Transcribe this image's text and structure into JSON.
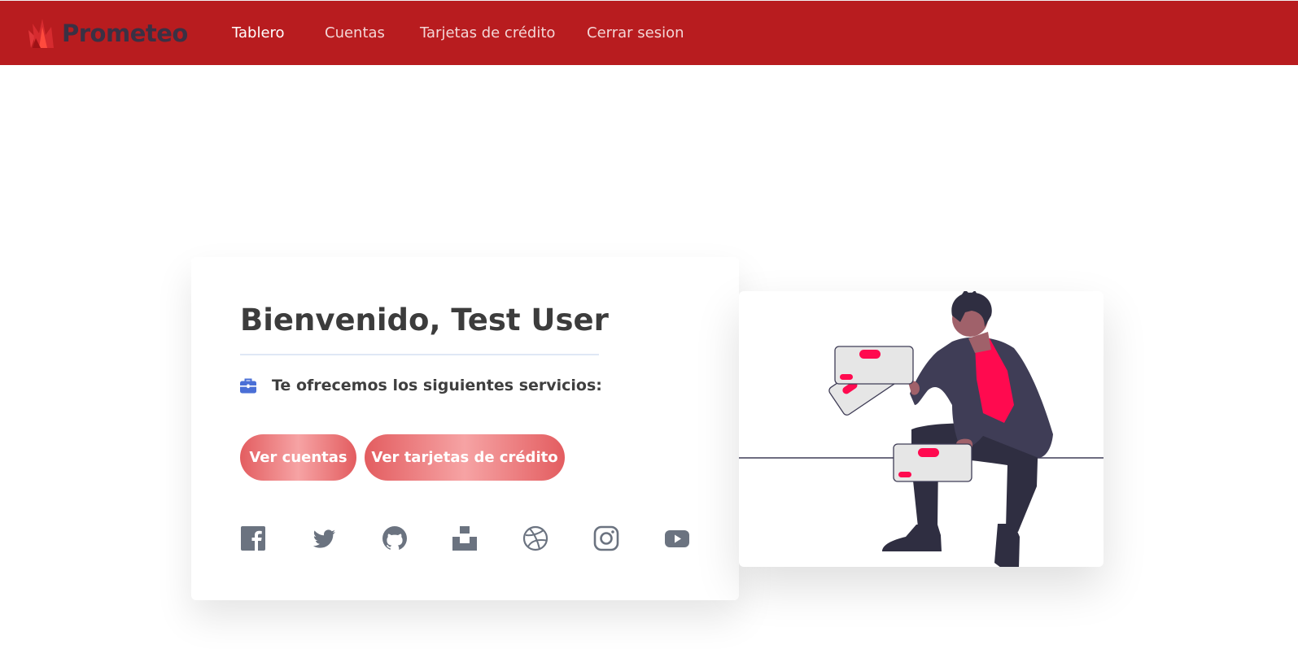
{
  "brand": {
    "name": "Prometeo"
  },
  "nav": {
    "items": [
      {
        "label": "Tablero",
        "active": true
      },
      {
        "label": "Cuentas",
        "active": false
      },
      {
        "label": "Tarjetas de crédito",
        "active": false
      },
      {
        "label": "Cerrar sesion",
        "active": false
      }
    ]
  },
  "welcome": {
    "title": "Bienvenido, Test User",
    "services_text": "Te ofrecemos los siguientes servicios:",
    "services_icon": "briefcase-icon"
  },
  "buttons": {
    "accounts": "Ver cuentas",
    "cards": "Ver tarjetas de crédito"
  },
  "social": [
    "facebook-icon",
    "twitter-icon",
    "github-icon",
    "unsplash-icon",
    "dribbble-icon",
    "instagram-icon",
    "youtube-icon"
  ],
  "colors": {
    "navbar": "#b81c1f",
    "button_gradient_edge": "#e35d60",
    "button_gradient_center": "#f6a3a4",
    "accent_pink": "#ff0a4f",
    "icon_gray": "#6b7380",
    "icon_blue": "#4a6fd6"
  }
}
